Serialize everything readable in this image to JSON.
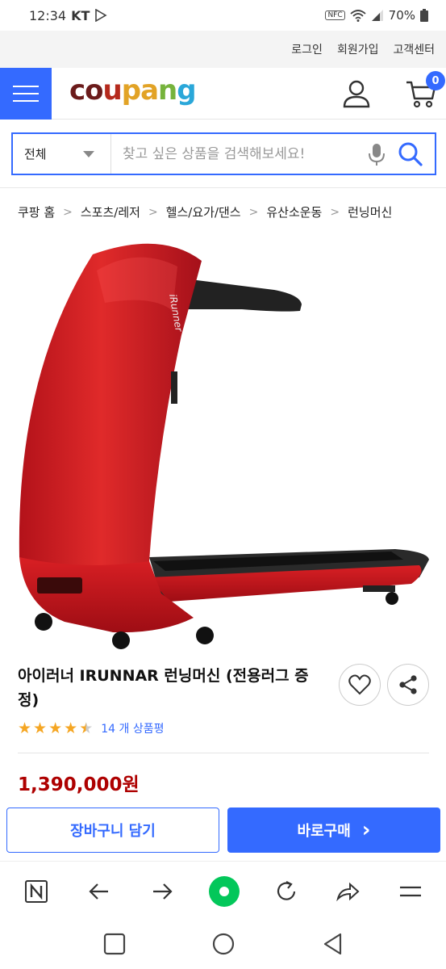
{
  "status_bar": {
    "time": "12:34",
    "carrier": "KT",
    "battery": "70%"
  },
  "top_nav": {
    "login": "로그인",
    "signup": "회원가입",
    "customer_center": "고객센터"
  },
  "header": {
    "logo": {
      "c": "c",
      "o": "o",
      "u": "u",
      "p": "p",
      "a": "a",
      "n": "n",
      "g": "g"
    },
    "cart_count": "0"
  },
  "search": {
    "category": "전체",
    "placeholder": "찾고 싶은 상품을 검색해보세요!"
  },
  "breadcrumb": [
    "쿠팡 홈",
    "스포츠/레저",
    "헬스/요가/댄스",
    "유산소운동",
    "런닝머신"
  ],
  "product": {
    "brand_text": "iRunner",
    "title": "아이러너 IRUNNAR 런닝머신 (전용러그 증정)",
    "rating": 4.5,
    "review_count": "14 개 상품평",
    "price": "1,390,000원"
  },
  "actions": {
    "add_to_cart": "장바구니 담기",
    "buy_now": "바로구매",
    "buy_chevron": "›"
  },
  "colors": {
    "accent": "#346aff",
    "price": "#ae0000",
    "treadmill": "#d81e1e",
    "star": "#f5a623"
  }
}
